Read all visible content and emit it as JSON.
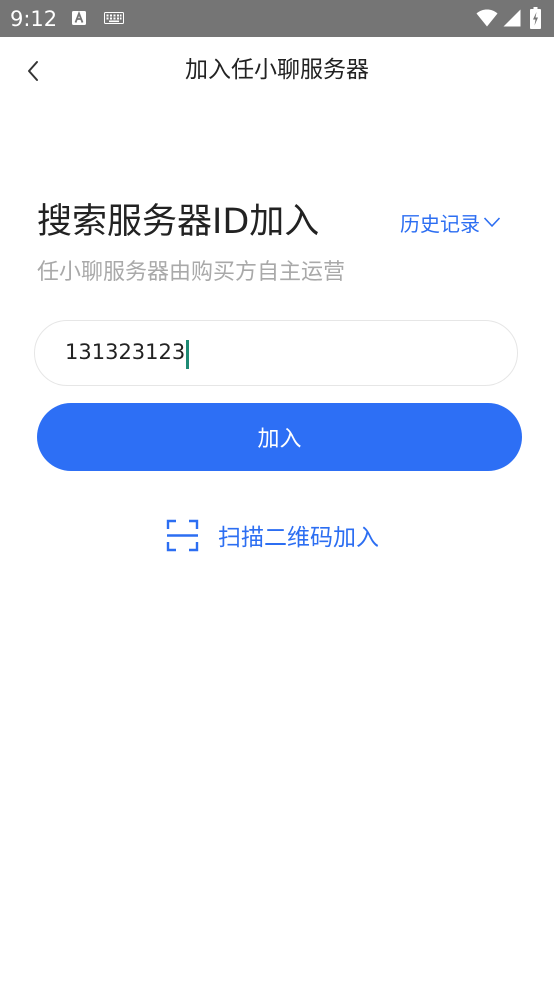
{
  "status_bar": {
    "time": "9:12",
    "background": "#757575",
    "icons": [
      "text-a-icon",
      "keyboard-icon",
      "wifi-icon",
      "cell-signal-icon",
      "battery-charging-icon"
    ]
  },
  "header": {
    "back_icon": "chevron-left-icon",
    "title": "加入任小聊服务器"
  },
  "main": {
    "heading": "搜索服务器ID加入",
    "history_label": "历史记录",
    "history_icon": "chevron-down-icon",
    "subheading": "任小聊服务器由购买方自主运营",
    "id_input": {
      "value": "131323123",
      "placeholder": ""
    },
    "join_button_label": "加入",
    "scan_label": "扫描二维码加入",
    "scan_icon": "scan-frame-icon"
  },
  "colors": {
    "accent": "#2c6ef2",
    "button_bg": "#2d6ff5",
    "caret": "#1e8a74",
    "subtext": "#a9a9a9",
    "text": "#222222"
  }
}
